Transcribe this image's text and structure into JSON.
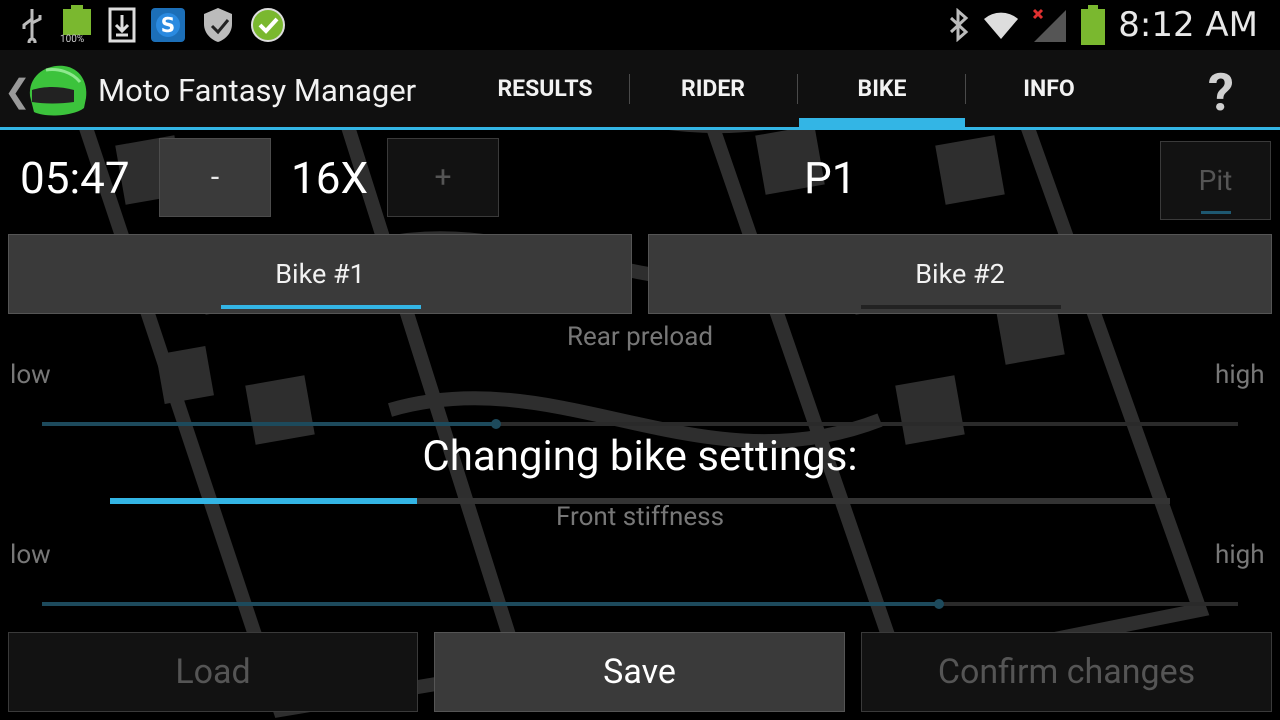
{
  "status_bar": {
    "battery_left_label": "100%",
    "time": "8:12 AM",
    "icons": [
      "usb-icon",
      "battery-icon",
      "download-icon",
      "skype-icon",
      "shield-icon",
      "check-icon",
      "bluetooth-icon",
      "wifi-icon",
      "signal-icon",
      "battery-icon"
    ]
  },
  "action_bar": {
    "up_glyph": "❮",
    "title": "Moto Fantasy Manager",
    "tabs": [
      {
        "label": "RESULTS",
        "active": false
      },
      {
        "label": "RIDER",
        "active": false
      },
      {
        "label": "BIKE",
        "active": true
      },
      {
        "label": "INFO",
        "active": false
      }
    ],
    "help_glyph": "?"
  },
  "race": {
    "timer": "05:47",
    "minus_label": "-",
    "speed": "16X",
    "plus_label": "+",
    "position": "P1",
    "pit_label": "Pit"
  },
  "bike_tabs": [
    {
      "label": "Bike #1",
      "selected": true
    },
    {
      "label": "Bike #2",
      "selected": false
    }
  ],
  "settings": [
    {
      "name": "Rear preload",
      "low": "low",
      "high": "high",
      "level": 0.38
    },
    {
      "name": "Front stiffness",
      "low": "low",
      "high": "high",
      "level": 0.75
    }
  ],
  "dialog": {
    "title": "Changing bike settings:",
    "progress": 0.29
  },
  "buttons": {
    "load": "Load",
    "save": "Save",
    "confirm": "Confirm changes"
  },
  "colors": {
    "accent": "#33b5e5",
    "helmet": "#3cc33c"
  }
}
